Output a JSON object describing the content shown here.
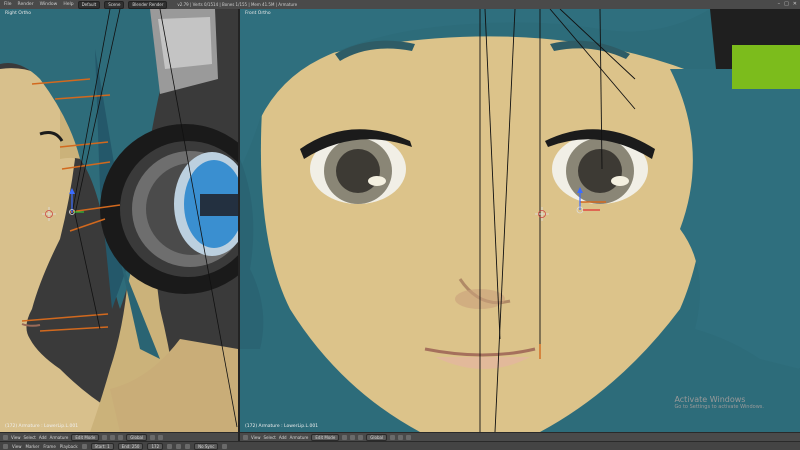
{
  "topbar": {
    "menu": [
      "File",
      "Render",
      "Window",
      "Help"
    ],
    "layout_field": "Default",
    "scene_field": "Scene",
    "engine": "Blender Render",
    "title": "v2.79 | Verts 0/1514 | Bones 1/155 | Mem 41.5M | Armature"
  },
  "left_view": {
    "label": "Right Ortho",
    "status": "(172) Armature : LowerLip.L.001"
  },
  "right_view": {
    "label": "Front Ortho",
    "status": "(172) Armature : LowerLip.L.001"
  },
  "left_header": {
    "items": [
      "View",
      "Select",
      "Add",
      "Armature"
    ],
    "mode": "Edit Mode",
    "pivot": "Global"
  },
  "right_header": {
    "items": [
      "View",
      "Select",
      "Add",
      "Armature"
    ],
    "mode": "Edit Mode",
    "pivot": "Global"
  },
  "timeline": {
    "items": [
      "View",
      "Marker",
      "Frame",
      "Playback"
    ],
    "start_label": "Start:",
    "start": "1",
    "end_label": "End:",
    "end": "250",
    "frame": "172",
    "sync": "No Sync"
  },
  "watermark": {
    "line1": "Activate Windows",
    "line2": "Go to Settings to activate Windows."
  },
  "colors": {
    "skin": "#dcc38a",
    "hair": "#2f6f7e",
    "bone": "#d2691e",
    "overlay_green": "#7cbc1c"
  },
  "icons": [
    "cursor-crosshair-icon",
    "3d-manipulator-icon",
    "headphone-object"
  ]
}
